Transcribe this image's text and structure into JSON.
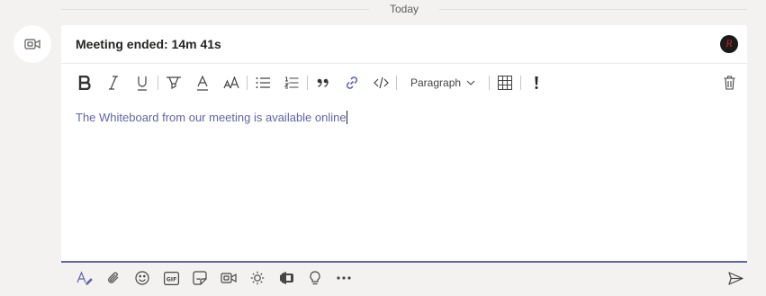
{
  "timeline": {
    "divider_label": "Today"
  },
  "card": {
    "title": "Meeting ended: 14m 41s",
    "user_avatar_initials": "R"
  },
  "toolbar": {
    "buttons": [
      "bold-icon",
      "italic-icon",
      "underline-icon",
      "highlight-icon",
      "font-color-icon",
      "font-size-icon",
      "bulleted-list-icon",
      "numbered-list-icon",
      "quote-icon",
      "link-icon",
      "code-icon",
      "table-icon",
      "important-icon",
      "delete-icon"
    ],
    "paragraph_label": "Paragraph"
  },
  "editor": {
    "text": "The Whiteboard from our meeting is available online"
  },
  "compose_actions": [
    "format-icon",
    "attach-icon",
    "emoji-icon",
    "gif-icon",
    "sticker-icon",
    "meet-now-icon",
    "praise-icon",
    "stream-icon",
    "idea-icon",
    "more-options-icon",
    "send-icon"
  ],
  "colors": {
    "accent": "#6264a7",
    "background": "#f3f2f1"
  }
}
